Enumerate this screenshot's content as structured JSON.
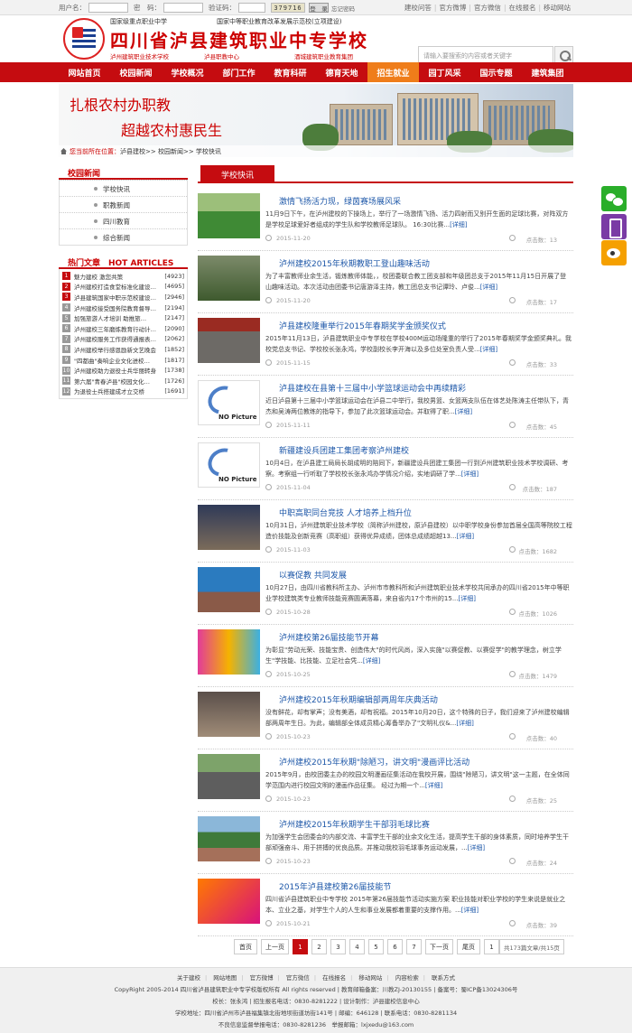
{
  "topbar": {
    "username_label": "用户名：",
    "password_label": "密　码：",
    "captcha_label": "验证码：",
    "captcha_value": "379716",
    "login_button": "登　录",
    "forgot_link": "忘记密码",
    "links": [
      "建校问答",
      "官方微博",
      "官方微信",
      "在线报名",
      "移动网站"
    ]
  },
  "header": {
    "line1_left": "国家级重点职业中学",
    "line1_right": "国家中等职业教育改革发展示范校(立项建设)",
    "school_name": "四川省泸县建筑职业中专学校",
    "sub1": "泸州建筑职业技术学校",
    "sub2": "泸县职教中心",
    "sub3": "酒城建筑职业教育集团",
    "search_placeholder": "请输入要搜索的内容或者关键字"
  },
  "nav": {
    "items": [
      "网站首页",
      "校园新闻",
      "学校概况",
      "部门工作",
      "教育科研",
      "德育天地",
      "招生就业",
      "园丁风采",
      "国示专题",
      "建筑集团"
    ],
    "active_index": 6,
    "active_color": "#ef7d1a",
    "bar_color": "#c50c10"
  },
  "banner": {
    "line1": "扎根农村办职教",
    "line2": "超越农村惠民生"
  },
  "breadcrumb": {
    "label": "您当前所在位置：",
    "path": "泸县建校>> 校园新闻>> 学校快讯"
  },
  "sidebar": {
    "section_title": "校园新闻",
    "items": [
      "学校快讯",
      "职教新闻",
      "四川教育",
      "综合新闻"
    ],
    "hot_title": "热门文章　HOT ARTICLES",
    "hot": [
      {
        "n": "1",
        "title": "魅力建校 激您共策",
        "count": "[4923]"
      },
      {
        "n": "2",
        "title": "泸州建校打造食堂标准化建设…",
        "count": "[4695]"
      },
      {
        "n": "3",
        "title": "泸县建筑国家中职示范校建设…",
        "count": "[2946]"
      },
      {
        "n": "4",
        "title": "泸州建校接受国务院教育督导…",
        "count": "[2194]"
      },
      {
        "n": "5",
        "title": "加强旅游人才培训 助推旅…",
        "count": "[2147]"
      },
      {
        "n": "6",
        "title": "泸州建校三年磨炼教育行动计…",
        "count": "[2090]"
      },
      {
        "n": "7",
        "title": "泸州建校服务工作获得通报表…",
        "count": "[2062]"
      },
      {
        "n": "8",
        "title": "泸州建校举行感恩励新文艺晚会",
        "count": "[1852]"
      },
      {
        "n": "9",
        "title": "\"四都曲\"奏响企业文化进校…",
        "count": "[1817]"
      },
      {
        "n": "10",
        "title": "泸州建校助力退役士兵华丽转身",
        "count": "[1738]"
      },
      {
        "n": "11",
        "title": "第六届\"青春泸县\"校园文化…",
        "count": "[1726]"
      },
      {
        "n": "12",
        "title": "为退役士兵搭建成才立交桥",
        "count": "[1691]"
      }
    ]
  },
  "main": {
    "section_title": "学校快讯",
    "more_text": "[详细]",
    "clicks_label": "点击数：",
    "articles": [
      {
        "title": "激情飞扬活力现，绿茵赛场展风采",
        "summary": "11月9日下午，在泸州建校的下操场上，举行了一场激情飞扬、活力四射而又别开生面的足球比赛，对阵双方是学校足球爱好者组成的学生队和学校教师足球队。 16:30比赛...",
        "date": "2015-11-20",
        "clicks": "13",
        "thumb": "soccer"
      },
      {
        "title": "泸州建校2015年秋期教职工登山趣味活动",
        "summary": "为了丰富教师业余生活，锻炼教师体能，，校团委联合教工团支部和年级团总支于2015年11月15日开展了登山趣味活动。本次活动由团委书记唐游泽主持，教工团总支书记谭玲、卢俊...",
        "date": "2015-11-20",
        "clicks": "17",
        "thumb": "mountain"
      },
      {
        "title": "泸县建校隆重举行2015年春期奖学金颁奖仪式",
        "summary": "2015年11月13日，泸县建筑职业中专学校在学校400M运动场隆重的举行了2015年春期奖学金颁奖典礼。我校党总支书记、学校校长张永鸿，学校副校长李开海以及多位处室负责人受...",
        "date": "2015-11-15",
        "clicks": "33",
        "thumb": "ceremony"
      },
      {
        "title": "泸县建校在县第十三届中小学篮球运动会中再续精彩",
        "summary": "近日泸县第十三届中小学篮球运动会在泸县二中举行，我校男篮、女篮两支队伍在体艺处陈涛主任带队下，青杰和吴涛两位教练的指导下，参加了此次篮球运动会。并取得了职...",
        "date": "2015-11-11",
        "clicks": "45",
        "thumb": "nopic"
      },
      {
        "title": "新疆建设兵团建工集团考察泸州建校",
        "summary": "10月4日，在泸县建工局局长胡成明的陪同下，新疆建设兵团建工集团一行到泸州建筑职业技术学校调研、考察。考察组一行听取了学校校长张永鸿办学情况介绍，实地调研了学...",
        "date": "2015-11-04",
        "clicks": "187",
        "thumb": "nopic"
      },
      {
        "title": "中职高职同台竞技 人才培养上档升位",
        "summary": "10月31日，泸州建筑职业技术学校（简称泸州建校，原泸县建校）以中职学校身份参加首届全国高等院校工程造价技能及创新竞赛（高职组）获得优异成绩，团体总成绩超越13...",
        "date": "2015-11-03",
        "clicks": "1682",
        "thumb": "hall"
      },
      {
        "title": "以赛促教 共同发展",
        "summary": "10月27日，由四川省教科所主办、泸州市市教科所和泸州建筑职业技术学校共同承办的四川省2015年中等职业学校建筑类专业教师技能竞赛圆满落幕，来自省内17个市州的15...",
        "date": "2015-10-28",
        "clicks": "1026",
        "thumb": "stage"
      },
      {
        "title": "泸州建校第26届技能节开幕",
        "summary": "为彰显\"劳动光荣、技能宝贵、创造伟大\"的时代风尚，深入实施\"以赛促教、以赛促学\"的教学理念，树立学生\"学技能、比技能、立足社会凭...",
        "date": "2015-10-25",
        "clicks": "1479",
        "thumb": "festival"
      },
      {
        "title": "泸州建校2015年秋期编辑部两周年庆典活动",
        "summary": "没有鲜花，却有掌声；没有美酒，却有祝福。2015年10月20日，这个特殊的日子，我们迎来了泸州建校编辑部两周年生日。为此，编辑部全体成员精心筹备举办了\"文明礼仪&...",
        "date": "2015-10-23",
        "clicks": "40",
        "thumb": "room"
      },
      {
        "title": "泸州建校2015年秋期\"除陋习，讲文明\"漫画评比活动",
        "summary": "2015年9月，由校团委主办的校园文明漫画征集活动在我校开展，围绕\"除陋习，讲文明\"这一主题，在全体同学范围内进行校园文明的漫画作品征集。 经过为期一个...",
        "date": "2015-10-23",
        "clicks": "25",
        "thumb": "crowd"
      },
      {
        "title": "泸州建校2015年秋期学生干部羽毛球比赛",
        "summary": "为加强学生会团委会的内部交流、丰富学生干部的业余文化生活，提高学生干部的身体素质，同时培养学生干部顽强奋斗、用于拼搏的优良品质。并推动我校羽毛球事务运动发展，...",
        "date": "2015-10-23",
        "clicks": "24",
        "thumb": "court"
      },
      {
        "title": "2015年泸县建校第26届技能节",
        "summary": "四川省泸县建筑职业中专学校 2015年第26届技能节活动实施方案 职业技能对职业学校的学生来说是就业之本、立业之基，对学生个人的人生和事业发展都着重要的支撑作用。...",
        "date": "2015-10-21",
        "clicks": "39",
        "thumb": "poster"
      }
    ]
  },
  "pager": {
    "first": "首页",
    "prev": "上一页",
    "pages": [
      "1",
      "2",
      "3",
      "4",
      "5",
      "6",
      "7"
    ],
    "current": "1",
    "next": "下一页",
    "last": "尾页",
    "jump": "1",
    "info": "共173篇文章/共15页"
  },
  "footer": {
    "links": [
      "关于建校",
      "网站地图",
      "官方微博",
      "官方微信",
      "在线报名",
      "移动网站",
      "内容检索",
      "联系方式"
    ],
    "copyright": "CopyRight 2005-2014 四川省泸县建筑职业中专学校版权所有 All rights reserved | 教育邮箱备案：川教ZJ-20130155 | 备案号：蜀ICP备13024306号",
    "staff": "校长：张永鸿 | 招生报名电话：0830-8281222 | 设计制作：泸县建校信息中心",
    "address": "学校地址：四川省泸州市泸县福集镇北街地坝街道坊街141号 | 邮编：646128 | 联系电话：0830-8281134",
    "report": "不良信息监督举报电话：0830-8281236　举报邮箱：lxjxedu@163.com"
  }
}
